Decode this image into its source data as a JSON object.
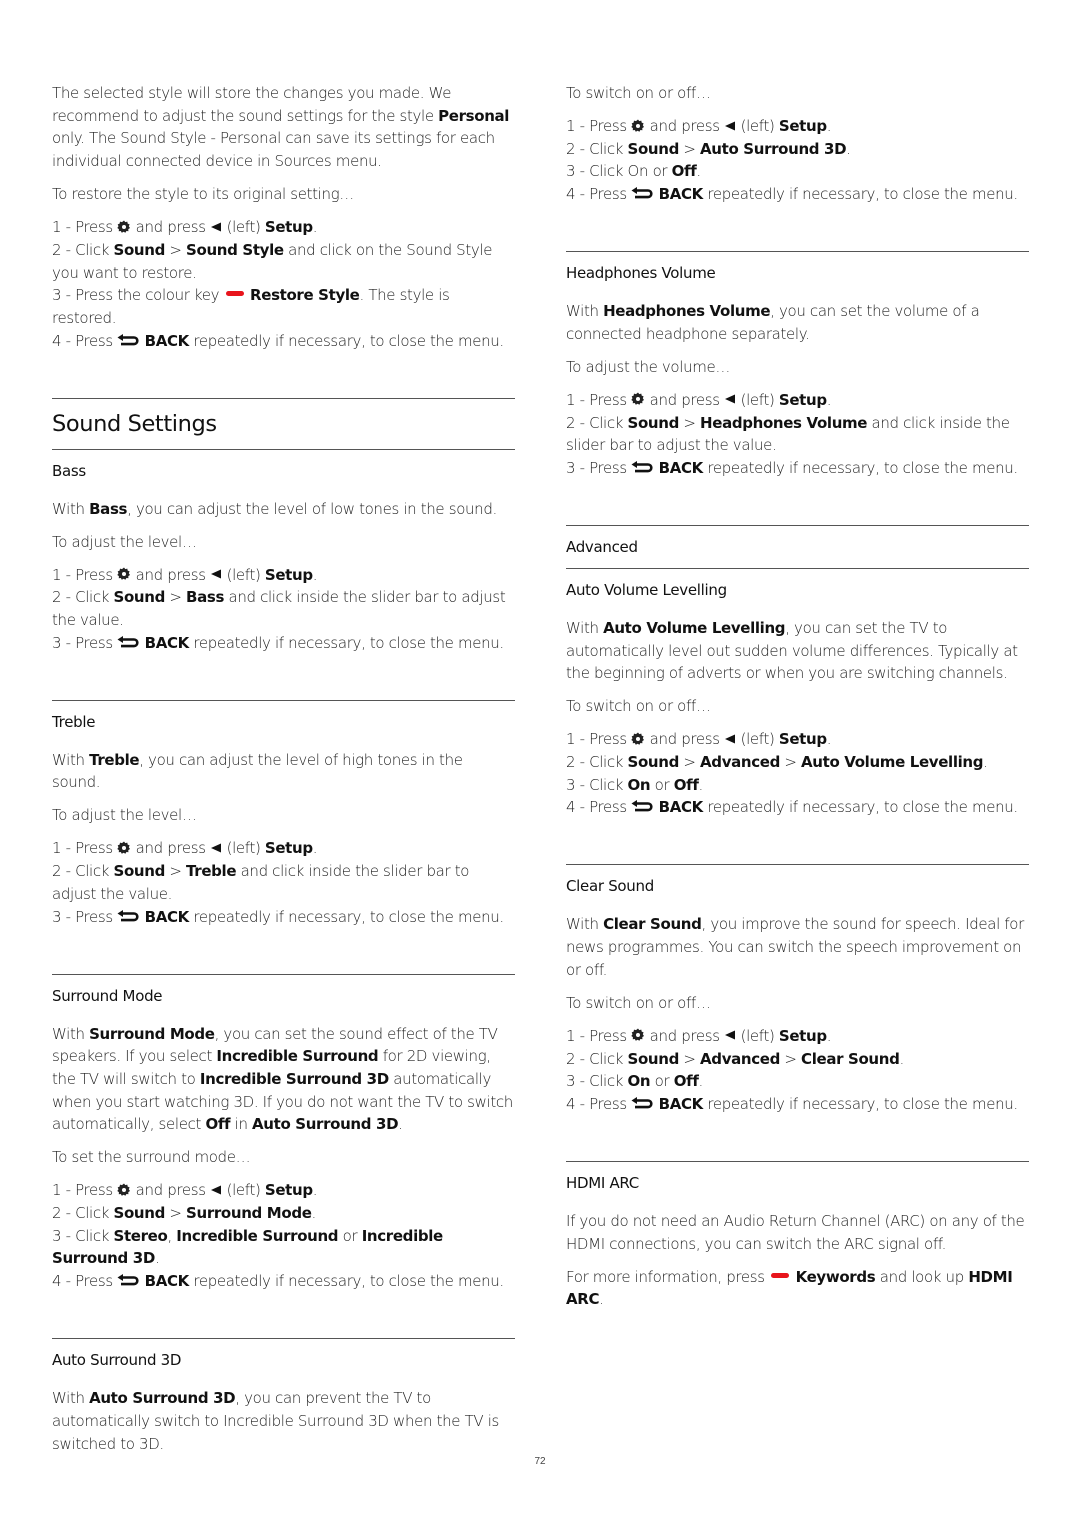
{
  "page_number": "72",
  "colors": {
    "red_key": "#e8141c",
    "rule": "#555555"
  },
  "icons": {
    "settings": "gear-icon",
    "left": "left-triangle-icon",
    "back": "back-arrow-icon",
    "red_key": "red-colour-key-icon"
  },
  "common": {
    "press": "Press",
    "and_press": "and press",
    "left": "(left)",
    "setup": "Setup",
    "click": "Click",
    "sound": "Sound",
    "gt": ">",
    "back": "BACK",
    "back_rest": "repeatedly if necessary, to close the menu.",
    "on": "On",
    "or": "or",
    "off": "Off",
    "advanced": "Advanced",
    "dot": "."
  },
  "intro": {
    "p1_a": "The selected style will store the changes you made. We recommend to adjust the sound settings for the style",
    "p1_bold": "Personal",
    "p1_b": "only. The Sound Style - Personal can save its settings for each individual connected device in Sources menu.",
    "p2": "To restore the style to its original setting…",
    "step1_num": "1 - ",
    "step2_num": "2 - ",
    "step2_bold": "Sound Style",
    "step2_rest": "and click on the Sound Style you want to restore.",
    "step3_num": "3 - ",
    "step3_a": "Press the colour key",
    "step3_bold": "Restore Style",
    "step3_rest": ". The style is restored.",
    "step4_num": "4 - "
  },
  "page_heading": "Sound Settings",
  "bass": {
    "heading": "Bass",
    "desc_a": "With",
    "desc_bold": "Bass",
    "desc_b": ", you can adjust the level of low tones in the sound.",
    "lead": "To adjust the level…",
    "step2_bold": "Bass",
    "step2_rest": "and click inside the slider bar to adjust the value."
  },
  "treble": {
    "heading": "Treble",
    "desc_a": "With",
    "desc_bold": "Treble",
    "desc_b": ", you can adjust the level of high tones in the sound.",
    "lead": "To adjust the level…",
    "step2_bold": "Treble",
    "step2_rest": "and click inside the slider bar to adjust the value."
  },
  "surround_mode": {
    "heading": "Surround Mode",
    "d1": "With",
    "d1b": "Surround Mode",
    "d2": ", you can set the sound effect of the TV speakers. If you select",
    "d2b": "Incredible Surround",
    "d3": "for 2D viewing, the TV will switch to",
    "d3b": "Incredible Surround 3D",
    "d4": "automatically when you start watching 3D. If you do not want the TV to switch automatically, select",
    "d4b": "Off",
    "d5": "in",
    "d5b": "Auto Surround 3D",
    "d6": ".",
    "lead": "To set the surround mode…",
    "step2_bold": "Surround Mode",
    "step3_b1": "Stereo",
    "step3_comma": ",",
    "step3_b2": "Incredible Surround",
    "step3_or": "or",
    "step3_b3": "Incredible Surround 3D"
  },
  "auto_surround": {
    "heading": "Auto Surround 3D",
    "desc_a": "With",
    "desc_bold": "Auto Surround 3D",
    "desc_b": ", you can prevent the TV to automatically switch to Incredible Surround 3D when the TV is switched to 3D.",
    "lead": "To switch on or off…",
    "step2_bold": "Auto Surround 3D",
    "step3_on": "On"
  },
  "headphones": {
    "heading": "Headphones Volume",
    "desc_a": "With",
    "desc_bold": "Headphones Volume",
    "desc_b": ", you can set the volume of a connected headphone separately.",
    "lead": "To adjust the volume…",
    "step2_bold": "Headphones Volume",
    "step2_rest": "and click inside the slider bar to adjust the value."
  },
  "advanced": {
    "heading": "Advanced"
  },
  "avl": {
    "heading": "Auto Volume Levelling",
    "desc_a": "With",
    "desc_bold": "Auto Volume Levelling",
    "desc_b": ", you can set the TV to automatically level out sudden volume differences. Typically at the beginning of adverts or when you are switching channels.",
    "lead": "To switch on or off…",
    "step2_bold": "Auto Volume Levelling"
  },
  "clear_sound": {
    "heading": "Clear Sound",
    "desc_a": "With",
    "desc_bold": "Clear Sound",
    "desc_b": ", you improve the sound for speech. Ideal for news programmes. You can switch the speech improvement on or off.",
    "lead": "To switch on or off…",
    "step2_bold": "Clear Sound"
  },
  "hdmi_arc": {
    "heading": "HDMI ARC",
    "desc": "If you do not need an Audio Return Channel (ARC) on any of the HDMI connections, you can switch the ARC signal off.",
    "more_a": "For more information, press",
    "more_bold": "Keywords",
    "more_b": "and look up",
    "more_bold2": "HDMI ARC",
    "more_c": "."
  }
}
